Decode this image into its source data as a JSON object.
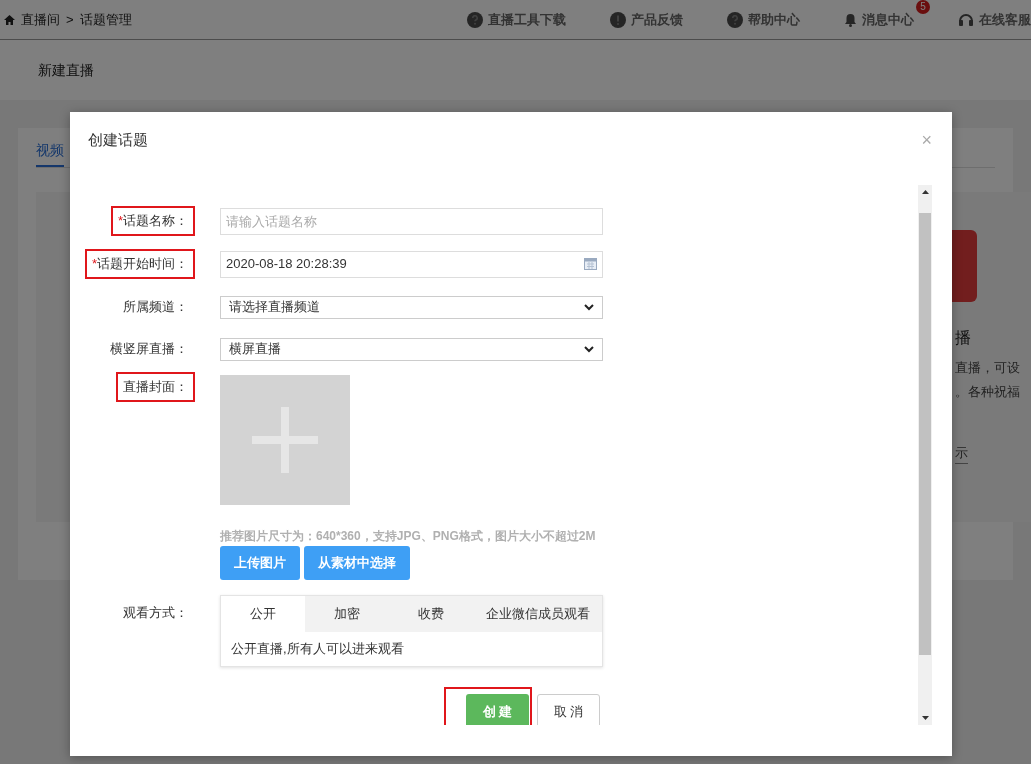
{
  "page": {
    "breadcrumb": [
      {
        "label": "直播间"
      },
      {
        "label": "话题管理"
      }
    ],
    "separator": ">",
    "header_links": [
      {
        "label": "直播工具下载",
        "kind": "help"
      },
      {
        "label": "产品反馈",
        "kind": "info"
      },
      {
        "label": "帮助中心",
        "kind": "help"
      },
      {
        "label": "消息中心",
        "kind": "bell",
        "badge": "5"
      },
      {
        "label": "在线客服",
        "kind": "service"
      }
    ],
    "section_title": "新建直播",
    "tab": "视频",
    "card_title": "播",
    "card_lines": [
      "直播，可设",
      "。各种祝福"
    ],
    "card_link": "示"
  },
  "dialog": {
    "title": "创建话题",
    "close": "×",
    "fields": [
      {
        "kind": "text",
        "label": "话题名称：",
        "required_mark": "*",
        "highlighted": true,
        "placeholder": "请输入话题名称"
      },
      {
        "kind": "date",
        "label": "话题开始时间：",
        "required_mark": "*",
        "highlighted": true,
        "value": "2020-08-18 20:28:39"
      },
      {
        "kind": "select",
        "label": "所属频道：",
        "highlighted": false,
        "value": "请选择直播频道"
      },
      {
        "kind": "select",
        "label": "横竖屏直播：",
        "highlighted": false,
        "value": "横屏直播"
      },
      {
        "kind": "cover",
        "label": "直播封面：",
        "highlighted": true,
        "hint": "推荐图片尺寸为：640*360，支持JPG、PNG格式，图片大小不超过2M",
        "buttons": [
          "上传图片",
          "从素材中选择"
        ]
      },
      {
        "kind": "tabs",
        "label": "观看方式：",
        "highlighted": false,
        "tabs": [
          {
            "label": "公开",
            "selected": true
          },
          {
            "label": "加密",
            "selected": false
          },
          {
            "label": "收费",
            "selected": false
          },
          {
            "label": "企业微信成员观看",
            "selected": false
          }
        ],
        "description": "公开直播,所有人可以进来观看"
      }
    ],
    "actions": [
      {
        "label": "创 建",
        "kind": "primary",
        "highlighted": true
      },
      {
        "label": "取 消",
        "kind": "default",
        "highlighted": false
      }
    ]
  }
}
